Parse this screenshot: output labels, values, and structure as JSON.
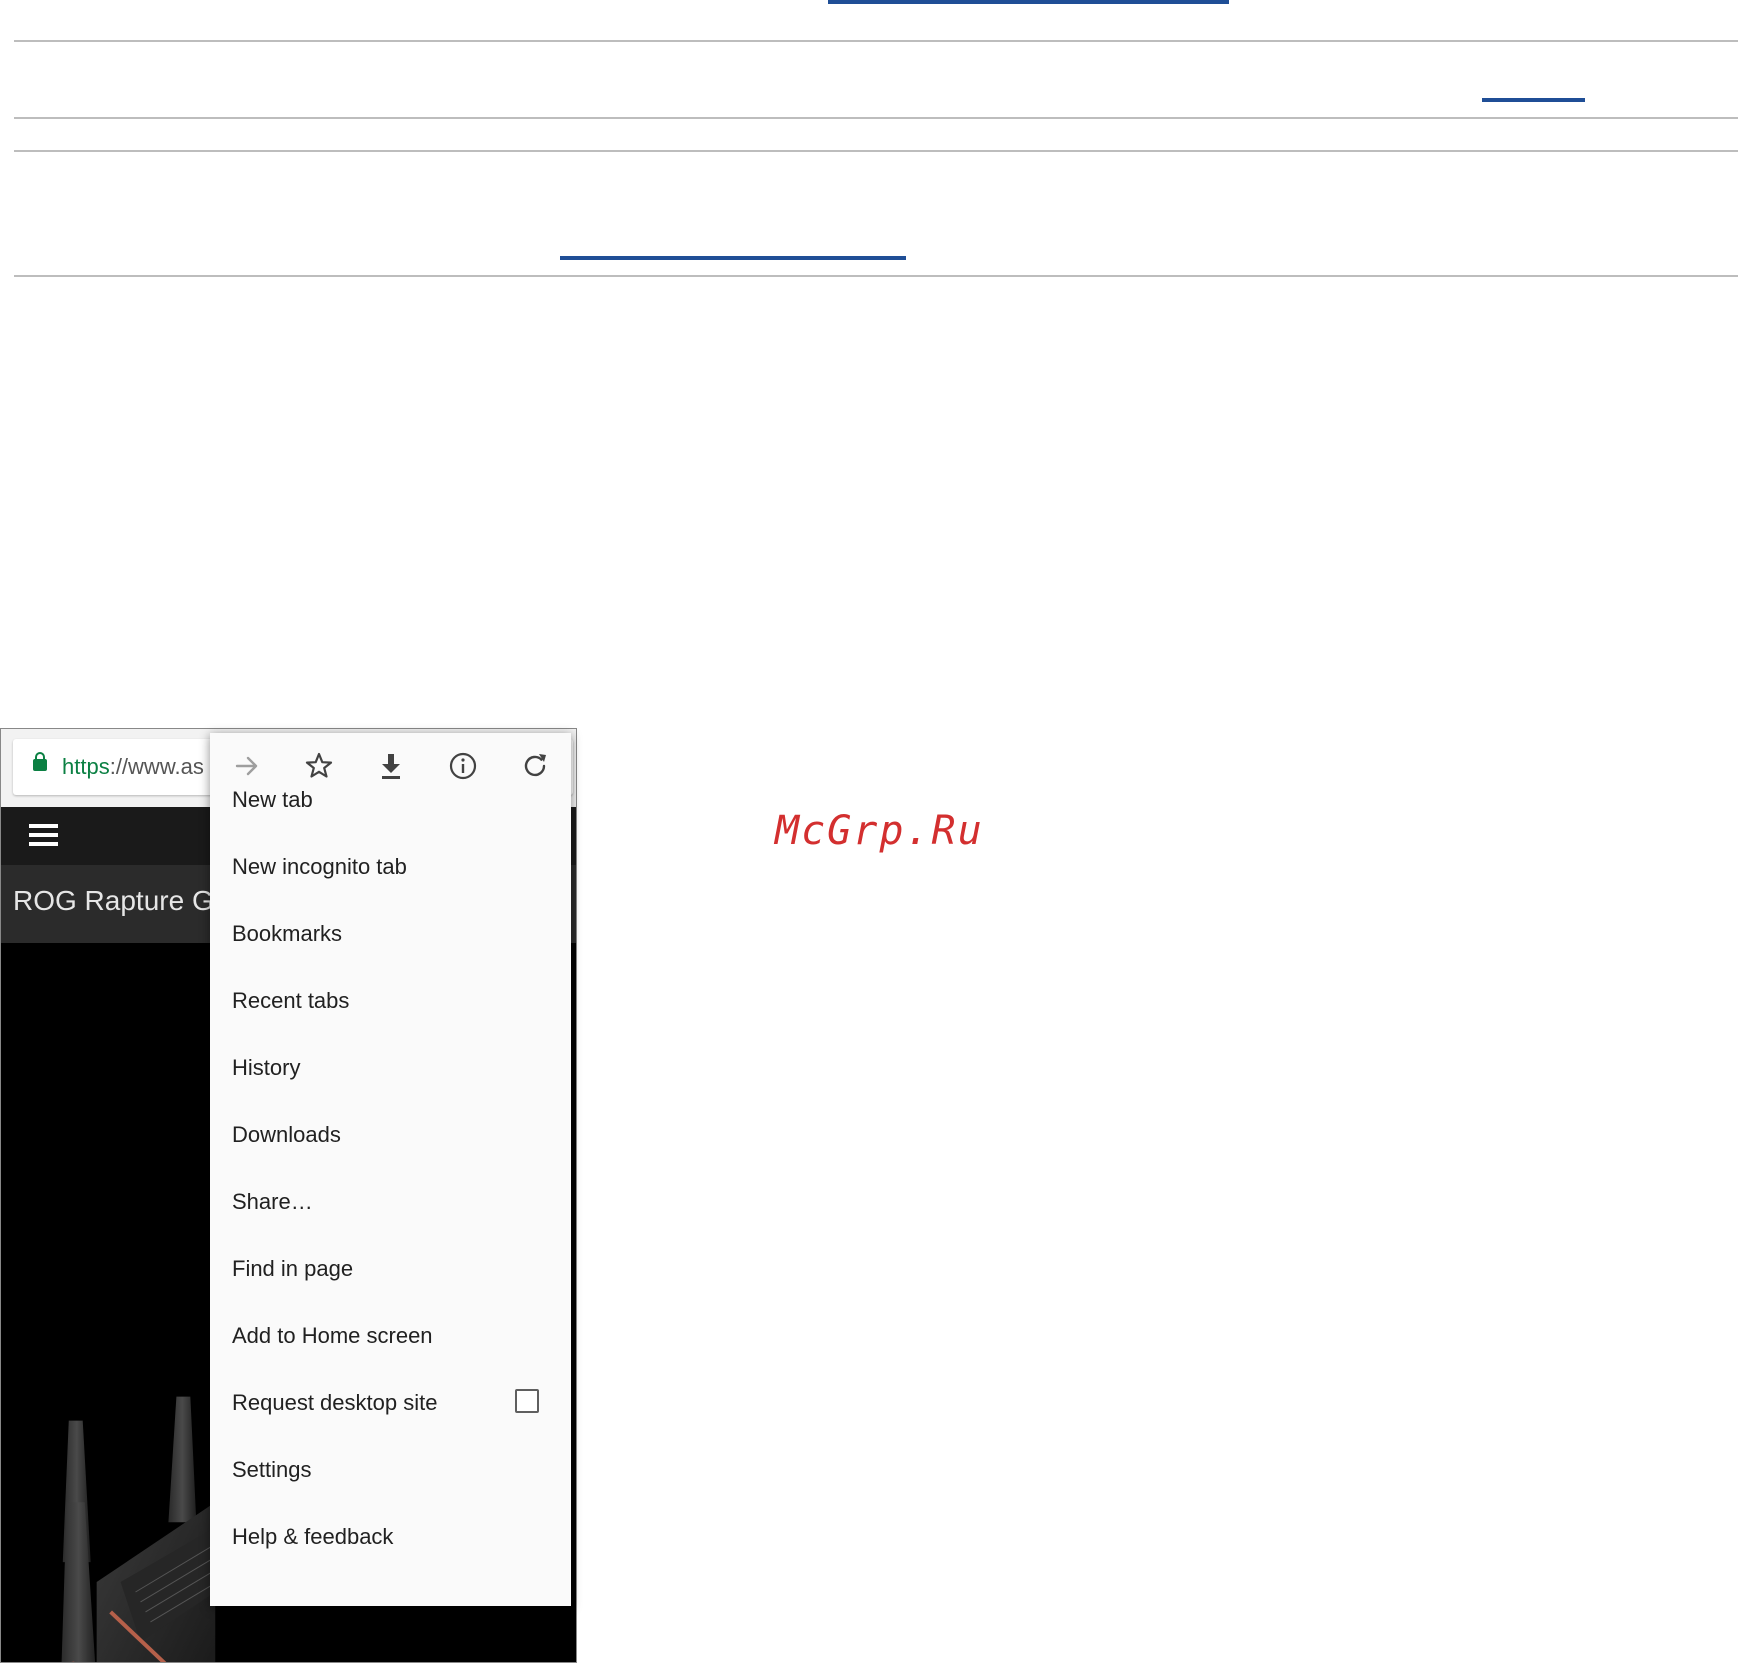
{
  "watermark": "McGrp.Ru",
  "browser": {
    "url_scheme": "https",
    "url_rest": "://www.as"
  },
  "site": {
    "title": "ROG Rapture GT"
  },
  "menu": {
    "icons": [
      "forward-icon",
      "bookmark-star-icon",
      "download-icon",
      "info-icon",
      "reload-icon"
    ],
    "items": [
      "New tab",
      "New incognito tab",
      "Bookmarks",
      "Recent tabs",
      "History",
      "Downloads",
      "Share…",
      "Find in page",
      "Add to Home screen",
      "Request desktop site",
      "Settings",
      "Help & feedback"
    ],
    "request_desktop_checked": false
  },
  "colors": {
    "link_blue": "#1f4e96",
    "secure_green": "#0b8043",
    "watermark_red": "#d32f2f"
  }
}
